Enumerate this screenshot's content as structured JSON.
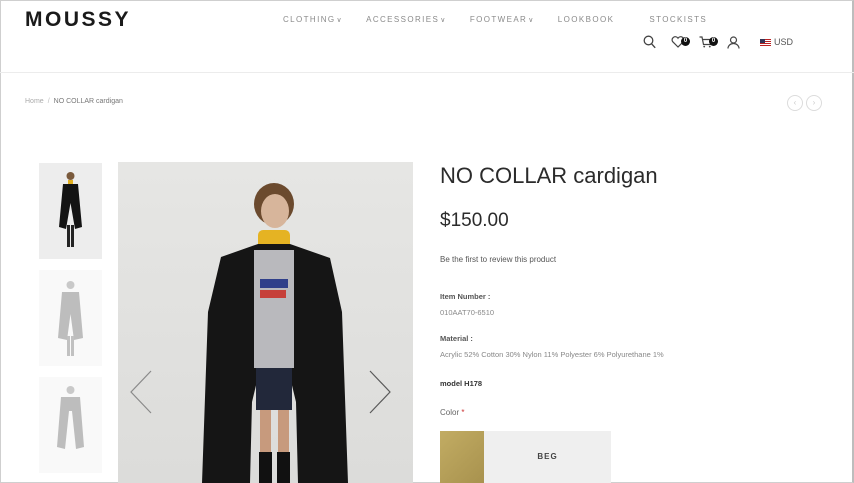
{
  "header": {
    "logo": "MOUSSY",
    "nav": [
      {
        "label": "CLOTHING",
        "dropdown": true
      },
      {
        "label": "ACCESSORIES",
        "dropdown": true
      },
      {
        "label": "FOOTWEAR",
        "dropdown": true
      },
      {
        "label": "LOOKBOOK",
        "dropdown": false
      },
      {
        "label": "STOCKISTS",
        "dropdown": false
      }
    ],
    "wishlist_count": "0",
    "cart_count": "0",
    "currency": "USD"
  },
  "breadcrumb": {
    "home": "Home",
    "separator": "/",
    "current": "NO COLLAR cardigan"
  },
  "product": {
    "title": "NO COLLAR cardigan",
    "price": "$150.00",
    "review_link": "Be the first to review this product",
    "item_number_label": "Item Number :",
    "item_number": "010AAT70-6510",
    "material_label": "Material :",
    "material": "Acrylic 52% Cotton 30% Nylon 11% Polyester 6% Polyurethane 1%",
    "model": "model H178",
    "color_label": "Color",
    "color_required": "*",
    "color_option": "BEG",
    "color_swatch": "#b89f58"
  },
  "colors": {
    "cardigan": "#151515",
    "turtleneck": "#e5b323",
    "background": "#e2e2e0"
  }
}
